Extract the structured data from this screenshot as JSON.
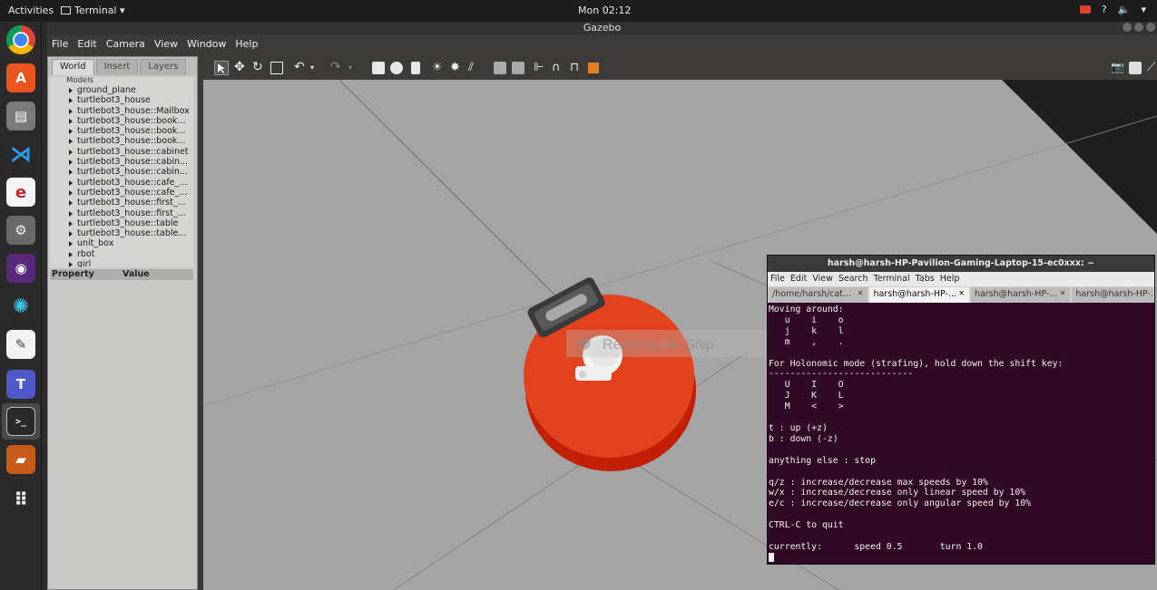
{
  "topbar": {
    "activities": "Activities",
    "app_menu": "Terminal ▾",
    "clock": "Mon 02:12",
    "tray": [
      "?",
      "🔈",
      "▾"
    ]
  },
  "dock": {
    "icons": [
      "chrome-icon",
      "software-center-icon",
      "files-icon",
      "vscode-icon",
      "text-app-icon",
      "settings-tools-icon",
      "screen-recorder-icon",
      "ros-icon",
      "text-editor-icon",
      "teams-icon",
      "terminal-icon",
      "book-icon",
      "app-grid-icon"
    ]
  },
  "gazebo": {
    "title": "Gazebo",
    "menu": [
      "File",
      "Edit",
      "Camera",
      "View",
      "Window",
      "Help"
    ],
    "tabs": [
      "World",
      "Insert",
      "Layers"
    ],
    "tree_header": "Models",
    "tree_items": [
      "ground_plane",
      "turtlebot3_house",
      "turtlebot3_house::Mailbox",
      "turtlebot3_house::book...",
      "turtlebot3_house::book...",
      "turtlebot3_house::book...",
      "turtlebot3_house::cabinet",
      "turtlebot3_house::cabin...",
      "turtlebot3_house::cabin...",
      "turtlebot3_house::cafe_...",
      "turtlebot3_house::cafe_...",
      "turtlebot3_house::first_...",
      "turtlebot3_house::first_...",
      "turtlebot3_house::table",
      "turtlebot3_house::table...",
      "unit_box",
      "rbot",
      "girl"
    ],
    "property_col": "Property",
    "value_col": "Value",
    "overlay_text": "Rectangular Snip"
  },
  "terminal": {
    "title": "harsh@harsh-HP-Pavilion-Gaming-Laptop-15-ec0xxx: ~",
    "menu": [
      "File",
      "Edit",
      "View",
      "Search",
      "Terminal",
      "Tabs",
      "Help"
    ],
    "tabs": [
      "/home/harsh/cat...",
      "harsh@harsh-HP-...",
      "harsh@harsh-HP-...",
      "harsh@harsh-HP-..."
    ],
    "lines": [
      "Moving around:",
      "   u    i    o",
      "   j    k    l",
      "   m    ,    .",
      "",
      "For Holonomic mode (strafing), hold down the shift key:",
      "---------------------------",
      "   U    I    O",
      "   J    K    L",
      "   M    <    >",
      "",
      "t : up (+z)",
      "b : down (-z)",
      "",
      "anything else : stop",
      "",
      "q/z : increase/decrease max speeds by 10%",
      "w/x : increase/decrease only linear speed by 10%",
      "e/c : increase/decrease only angular speed by 10%",
      "",
      "CTRL-C to quit",
      "",
      "currently:      speed 0.5       turn 1.0"
    ]
  }
}
